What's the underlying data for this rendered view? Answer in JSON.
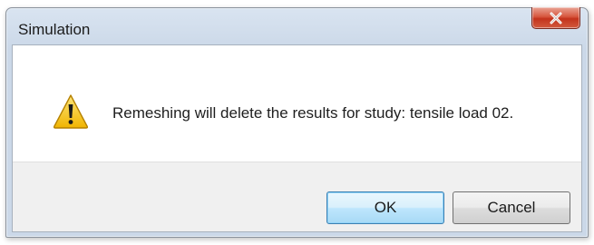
{
  "window": {
    "title": "Simulation",
    "close_icon": "close-icon"
  },
  "message": {
    "icon": "warning-icon",
    "text": "Remeshing will delete the results for study: tensile load 02."
  },
  "buttons": {
    "ok_label": "OK",
    "cancel_label": "Cancel"
  },
  "colors": {
    "close_button": "#c3331c",
    "ok_button_border": "#3c7fb1",
    "warning_fill": "#f5c518"
  }
}
